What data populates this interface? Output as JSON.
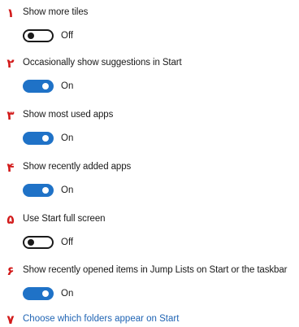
{
  "colors": {
    "accent": "#1f72c7",
    "marker": "#d21a1a",
    "link": "#1f64b4",
    "text": "#1a1a1a"
  },
  "markers": [
    "١",
    "٢",
    "٣",
    "۴",
    "۵",
    "۶",
    "٧"
  ],
  "settings": [
    {
      "label": "Show more tiles",
      "on": false,
      "state": "Off"
    },
    {
      "label": "Occasionally show suggestions in Start",
      "on": true,
      "state": "On"
    },
    {
      "label": "Show most used apps",
      "on": true,
      "state": "On"
    },
    {
      "label": "Show recently added apps",
      "on": true,
      "state": "On"
    },
    {
      "label": "Use Start full screen",
      "on": false,
      "state": "Off"
    },
    {
      "label": "Show recently opened items in Jump Lists on Start or the taskbar",
      "on": true,
      "state": "On"
    }
  ],
  "link": {
    "label": "Choose which folders appear on Start"
  }
}
